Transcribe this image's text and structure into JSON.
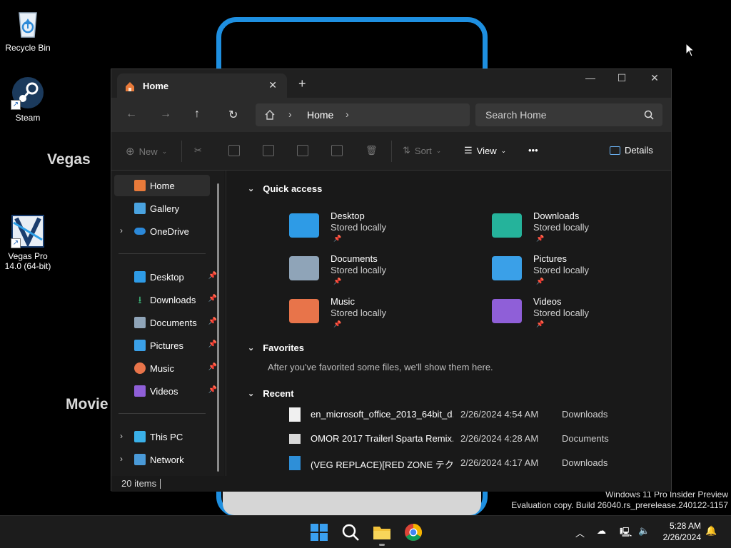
{
  "desktop": {
    "icons": [
      {
        "label": "Recycle Bin"
      },
      {
        "label": "Steam"
      },
      {
        "label": "Vegas Pro 14.0 (64-bit)"
      }
    ],
    "wallpaper_text": [
      "Vegas",
      "Movie"
    ]
  },
  "explorer": {
    "tab_title": "Home",
    "new_tab": "+",
    "address": {
      "crumb": "Home"
    },
    "search_placeholder": "Search Home",
    "commands": {
      "new": "New",
      "sort": "Sort",
      "view": "View",
      "more": "•••",
      "details": "Details"
    },
    "sidebar": {
      "top": [
        {
          "label": "Home"
        },
        {
          "label": "Gallery"
        },
        {
          "label": "OneDrive"
        }
      ],
      "pinned": [
        {
          "label": "Desktop"
        },
        {
          "label": "Downloads"
        },
        {
          "label": "Documents"
        },
        {
          "label": "Pictures"
        },
        {
          "label": "Music"
        },
        {
          "label": "Videos"
        }
      ],
      "bottom": [
        {
          "label": "This PC"
        },
        {
          "label": "Network"
        }
      ]
    },
    "quick_access": {
      "title": "Quick access",
      "items": [
        {
          "name": "Desktop",
          "status": "Stored locally",
          "color": "#2e9be6"
        },
        {
          "name": "Downloads",
          "status": "Stored locally",
          "color": "#25b39b"
        },
        {
          "name": "Documents",
          "status": "Stored locally",
          "color": "#8fa4b8"
        },
        {
          "name": "Pictures",
          "status": "Stored locally",
          "color": "#3aa0e8"
        },
        {
          "name": "Music",
          "status": "Stored locally",
          "color": "#e8744a"
        },
        {
          "name": "Videos",
          "status": "Stored locally",
          "color": "#8f5fd8"
        }
      ]
    },
    "favorites": {
      "title": "Favorites",
      "empty_text": "After you've favorited some files, we'll show them here."
    },
    "recent": {
      "title": "Recent",
      "items": [
        {
          "name": "en_microsoft_office_2013_64bit_d...",
          "date": "2/26/2024 4:54 AM",
          "location": "Downloads"
        },
        {
          "name": "OMOR 2017 Trailerl Sparta Remix...",
          "date": "2/26/2024 4:28 AM",
          "location": "Documents"
        },
        {
          "name": "(VEG REPLACE)[RED ZONE テクニッ...",
          "date": "2/26/2024 4:17 AM",
          "location": "Downloads"
        }
      ]
    },
    "status": "20 items"
  },
  "watermark": {
    "line1": "Windows 11 Pro Insider Preview",
    "line2": "Evaluation copy. Build 26040.rs_prerelease.240122-1157"
  },
  "taskbar": {
    "time": "5:28 AM",
    "date": "2/26/2024"
  }
}
